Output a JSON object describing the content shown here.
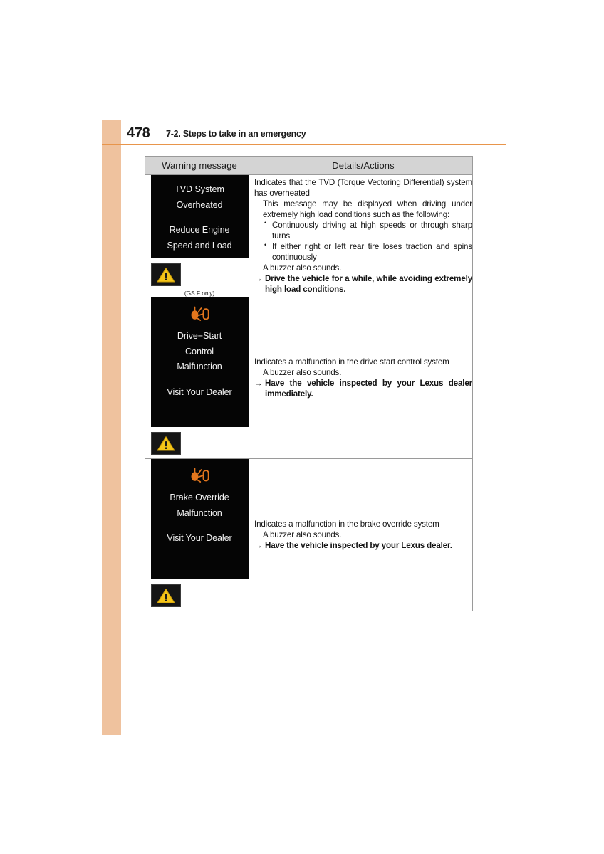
{
  "page": {
    "number": "478",
    "section_title": "7-2. Steps to take in an emergency",
    "accent_color": "#efc29e",
    "rule_color": "#e8954b"
  },
  "table": {
    "headers": {
      "warning_message": "Warning message",
      "details_actions": "Details/Actions"
    },
    "rows": [
      {
        "id": "tvd-system-overheated",
        "display": {
          "telltale_icon": "none",
          "lines": [
            "TVD System",
            "Overheated",
            "",
            "Reduce Engine",
            "Speed and Load"
          ]
        },
        "master_warning_icon": "warning-triangle-icon",
        "caption": "(GS F only)",
        "details": {
          "intro": "Indicates that the TVD (Torque Vectoring Differential) system has overheated",
          "note": "This message may be displayed when driving under extremely high load conditions such as the following:",
          "bullets": [
            "Continuously driving at high speeds or through sharp turns",
            "If either right or left rear tire loses traction and spins continuously"
          ],
          "buzzer": "A buzzer also sounds.",
          "action": "Drive the vehicle for a while, while avoiding extremely high load conditions."
        }
      },
      {
        "id": "drive-start-control-malfunction",
        "display": {
          "telltale_icon": "brake-override-telltale-icon",
          "lines": [
            "Drive−Start",
            "Control",
            "Malfunction",
            "",
            "Visit Your Dealer"
          ]
        },
        "master_warning_icon": "warning-triangle-icon",
        "caption": "",
        "details": {
          "intro": "Indicates a malfunction in the drive start control system",
          "note": "",
          "bullets": [],
          "buzzer": "A buzzer also sounds.",
          "action": "Have the vehicle inspected by your Lexus dealer immediately."
        }
      },
      {
        "id": "brake-override-malfunction",
        "display": {
          "telltale_icon": "brake-override-telltale-icon",
          "lines": [
            "Brake Override",
            "Malfunction",
            "",
            "Visit Your Dealer"
          ]
        },
        "master_warning_icon": "warning-triangle-icon",
        "caption": "",
        "details": {
          "intro": "Indicates a malfunction in the brake override system",
          "note": "",
          "bullets": [],
          "buzzer": "A buzzer also sounds.",
          "action": "Have the vehicle inspected by your Lexus dealer."
        }
      }
    ]
  },
  "colors": {
    "display_background": "#050505",
    "display_text": "#f2f2f2",
    "telltale_orange": "#e3761d",
    "warning_yellow": "#f5c518",
    "header_cell_background": "#d4d4d4"
  }
}
